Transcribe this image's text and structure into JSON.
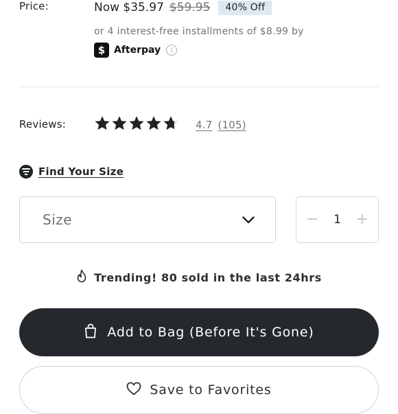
{
  "price": {
    "label": "Price:",
    "now": "Now $35.97",
    "was": "$59.95",
    "discount_badge": "40% Off",
    "installments": "or 4 interest-free installments of $8.99 by",
    "afterpay_logo": "$",
    "afterpay_label": "Afterpay",
    "info_icon": "i"
  },
  "reviews": {
    "label": "Reviews:",
    "rating": "4.7",
    "count": "(105)",
    "stars_filled_fraction": 0.94,
    "star_color": "#1f2326"
  },
  "find_size": {
    "label": "Find Your Size",
    "icon": "fit-guide-icon"
  },
  "size_select": {
    "placeholder": "Size",
    "icon": "chevron-down-icon"
  },
  "quantity": {
    "minus": "−",
    "value": "1",
    "plus": "+"
  },
  "trending": {
    "text": "Trending! 80 sold in the last 24hrs",
    "icon": "flame-icon"
  },
  "add_to_bag": {
    "label": "Add to Bag (Before It's Gone)",
    "icon": "shopping-bag-icon",
    "bg": "#25292d"
  },
  "favorites": {
    "label": "Save to Favorites",
    "icon": "heart-icon"
  },
  "colors": {
    "text": "#1f2326",
    "muted": "#6f7378",
    "badge_bg": "#dfe7ef",
    "border": "#d3d6d9"
  }
}
